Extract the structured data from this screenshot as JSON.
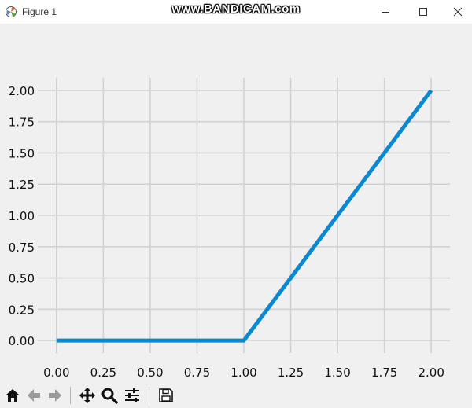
{
  "window": {
    "title": "Figure 1",
    "watermark": "www.BANDICAM.com"
  },
  "titlebar_buttons": [
    {
      "name": "minimize-button",
      "icon": "minimize-icon"
    },
    {
      "name": "maximize-button",
      "icon": "maximize-icon"
    },
    {
      "name": "close-button",
      "icon": "close-icon"
    }
  ],
  "toolbar": [
    {
      "name": "home-button",
      "icon": "home-icon"
    },
    {
      "name": "back-button",
      "icon": "arrow-left-icon"
    },
    {
      "name": "forward-button",
      "icon": "arrow-right-icon"
    },
    {
      "name": "pan-button",
      "icon": "move-icon"
    },
    {
      "name": "zoom-button",
      "icon": "magnifier-icon"
    },
    {
      "name": "configure-subplots-button",
      "icon": "sliders-icon"
    },
    {
      "name": "save-button",
      "icon": "floppy-disk-icon"
    }
  ],
  "chart_data": {
    "type": "line",
    "title": "",
    "xlabel": "",
    "ylabel": "",
    "xlim": [
      -0.1,
      2.1
    ],
    "ylim": [
      -0.1,
      2.1
    ],
    "xticks": [
      "0.00",
      "0.25",
      "0.50",
      "0.75",
      "1.00",
      "1.25",
      "1.50",
      "1.75",
      "2.00"
    ],
    "yticks": [
      "0.00",
      "0.25",
      "0.50",
      "0.75",
      "1.00",
      "1.25",
      "1.50",
      "1.75",
      "2.00"
    ],
    "grid": true,
    "series": [
      {
        "color": "#0a88d0",
        "x": [
          0.0,
          1.0,
          2.0
        ],
        "y": [
          0.0,
          0.0,
          2.0
        ]
      }
    ]
  }
}
